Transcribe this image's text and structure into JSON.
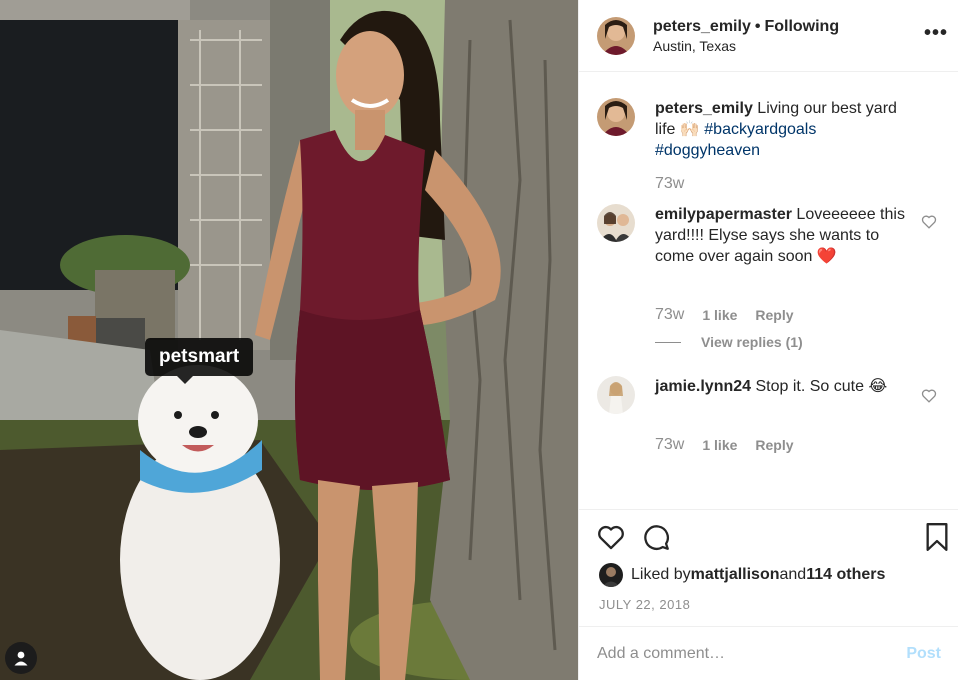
{
  "photo": {
    "tag_label": "petsmart"
  },
  "header": {
    "username": "peters_emily",
    "separator": "•",
    "follow_status": "Following",
    "location": "Austin, Texas",
    "more_icon": "more-horizontal-icon"
  },
  "caption": {
    "username": "peters_emily",
    "text": " Living our best yard life 🙌🏻 ",
    "hashtags": [
      "#backyardgoals",
      "#doggyheaven"
    ],
    "time": "73w"
  },
  "comments": [
    {
      "username": "emilypapermaster",
      "text": " Loveeeeee this yard!!!! Elyse says she wants to come over again soon ❤️",
      "time": "73w",
      "likes": "1 like",
      "reply": "Reply",
      "view_replies": "View replies (1)"
    },
    {
      "username": "jamie.lynn24",
      "text": " Stop it. So cute 😂",
      "time": "73w",
      "likes": "1 like",
      "reply": "Reply"
    }
  ],
  "liked_by": {
    "prefix": "Liked by ",
    "user": "mattjallison",
    "middle": " and ",
    "others": "114 others"
  },
  "date": "JULY 22, 2018",
  "add_comment": {
    "placeholder": "Add a comment…",
    "post_label": "Post"
  },
  "colors": {
    "hashtag": "#003569",
    "muted": "#8e8e8e",
    "post_disabled": "#b2dffc",
    "border": "#efefef"
  }
}
